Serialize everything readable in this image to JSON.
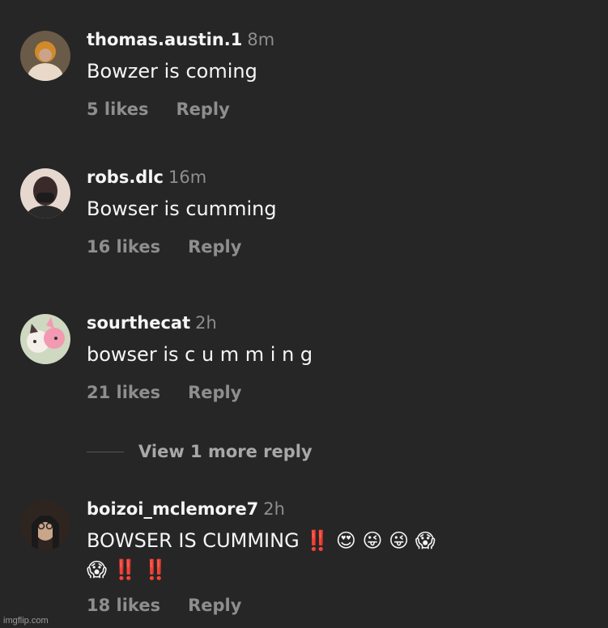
{
  "comments": [
    {
      "username": "thomas.austin.1",
      "time": "8m",
      "text": "Bowzer is coming",
      "likes": "5 likes",
      "reply": "Reply",
      "avatar_colors": [
        "#5b4a3a",
        "#d08a2a",
        "#e8d9c8"
      ]
    },
    {
      "username": "robs.dlc",
      "time": "16m",
      "text": "Bowser is cumming",
      "likes": "16 likes",
      "reply": "Reply",
      "avatar_colors": [
        "#e6d7cf",
        "#3a2b2b",
        "#1c1c1c"
      ]
    },
    {
      "username": "sourthecat",
      "time": "2h",
      "text": "bowser is c u m m i n g",
      "likes": "21 likes",
      "reply": "Reply",
      "avatar_colors": [
        "#cfd8c0",
        "#f29ab2",
        "#4a3a3a"
      ]
    },
    {
      "username": "boizoi_mclemore7",
      "time": "2h",
      "text_line1": "BOWSER IS CUMMING ‼️ 😍 😜 😜 😱",
      "text_line2": "😱 ‼️ ‼️",
      "likes": "18 likes",
      "reply": "Reply",
      "avatar_colors": [
        "#2e2420",
        "#c9a58a",
        "#1a1a1a"
      ]
    }
  ],
  "view_more": "View 1 more reply",
  "watermark": "imgflip.com",
  "colors": {
    "background": "#262626",
    "primary_text": "#f5f5f5",
    "secondary_text": "#8e8e8e"
  }
}
